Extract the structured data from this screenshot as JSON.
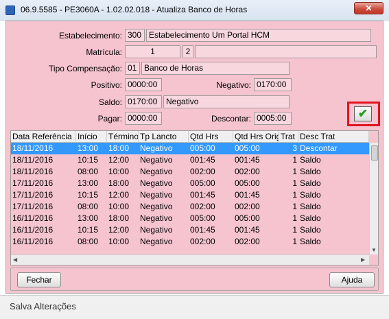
{
  "window": {
    "title": "06.9.5585 - PE3060A - 1.02.02.018 - Atualiza Banco de Horas",
    "close_glyph": "✕"
  },
  "form": {
    "estabelecimento": {
      "label": "Estabelecimento:",
      "code": "300",
      "name": "Estabelecimento Um Portal HCM"
    },
    "matricula": {
      "label": "Matrícula:",
      "number": "1",
      "digit": "2",
      "name": ""
    },
    "tipo_compensacao": {
      "label": "Tipo Compensação:",
      "code": "01",
      "name": "Banco de Horas"
    },
    "positivo": {
      "label": "Positivo:",
      "value": "0000:00"
    },
    "negativo": {
      "label": "Negativo:",
      "value": "0170:00"
    },
    "saldo": {
      "label": "Saldo:",
      "value": "0170:00",
      "desc": "Negativo"
    },
    "pagar": {
      "label": "Pagar:",
      "value": "0000:00"
    },
    "descontar": {
      "label": "Descontar:",
      "value": "0005:00"
    },
    "confirm_icon": "checkmark-icon",
    "confirm_glyph": "✔"
  },
  "grid": {
    "columns": [
      "Data Referência",
      "Início",
      "Término",
      "Tp Lancto",
      "Qtd Hrs",
      "Qtd Hrs Orig",
      "Trat",
      "Desc Trat"
    ],
    "rows": [
      [
        "18/11/2016",
        "13:00",
        "18:00",
        "Negativo",
        "005:00",
        "005:00",
        "3",
        "Descontar"
      ],
      [
        "18/11/2016",
        "10:15",
        "12:00",
        "Negativo",
        "001:45",
        "001:45",
        "1",
        "Saldo"
      ],
      [
        "18/11/2016",
        "08:00",
        "10:00",
        "Negativo",
        "002:00",
        "002:00",
        "1",
        "Saldo"
      ],
      [
        "17/11/2016",
        "13:00",
        "18:00",
        "Negativo",
        "005:00",
        "005:00",
        "1",
        "Saldo"
      ],
      [
        "17/11/2016",
        "10:15",
        "12:00",
        "Negativo",
        "001:45",
        "001:45",
        "1",
        "Saldo"
      ],
      [
        "17/11/2016",
        "08:00",
        "10:00",
        "Negativo",
        "002:00",
        "002:00",
        "1",
        "Saldo"
      ],
      [
        "16/11/2016",
        "13:00",
        "18:00",
        "Negativo",
        "005:00",
        "005:00",
        "1",
        "Saldo"
      ],
      [
        "16/11/2016",
        "10:15",
        "12:00",
        "Negativo",
        "001:45",
        "001:45",
        "1",
        "Saldo"
      ],
      [
        "16/11/2016",
        "08:00",
        "10:00",
        "Negativo",
        "002:00",
        "002:00",
        "1",
        "Saldo"
      ]
    ],
    "selected_row": 0
  },
  "buttons": {
    "fechar": "Fechar",
    "ajuda": "Ajuda"
  },
  "status": {
    "text": "Salva Alterações"
  }
}
